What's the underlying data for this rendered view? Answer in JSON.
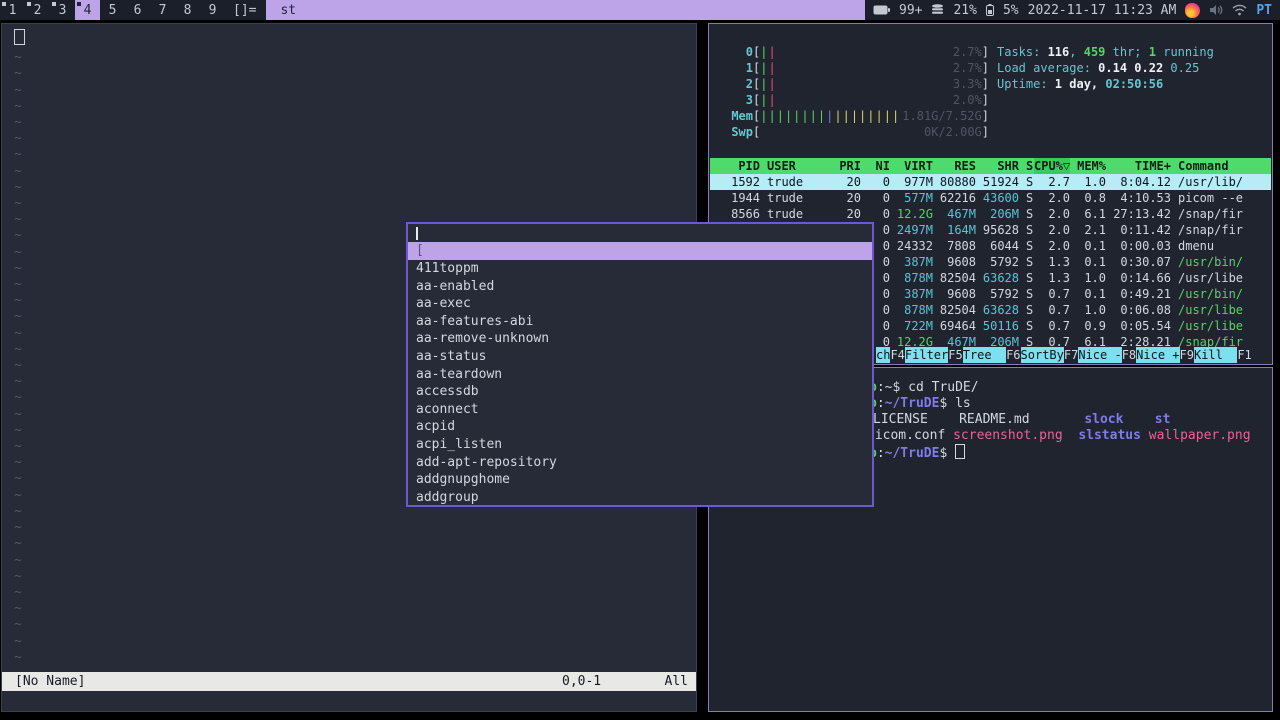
{
  "bar": {
    "workspaces": [
      {
        "label": "1",
        "indicator": true,
        "selected": false
      },
      {
        "label": "2",
        "indicator": true,
        "selected": false
      },
      {
        "label": "3",
        "indicator": true,
        "selected": false
      },
      {
        "label": "4",
        "indicator": true,
        "selected": true
      },
      {
        "label": "5",
        "indicator": false,
        "selected": false
      },
      {
        "label": "6",
        "indicator": false,
        "selected": false
      },
      {
        "label": "7",
        "indicator": false,
        "selected": false
      },
      {
        "label": "8",
        "indicator": false,
        "selected": false
      },
      {
        "label": "9",
        "indicator": false,
        "selected": false
      }
    ],
    "layout_symbol": "[]=",
    "window_title": "st",
    "status": {
      "battery": "99+",
      "memory": "21%",
      "cpu": "5%",
      "clock": "2022-11-17 11:23 AM",
      "keyboard_layout": "PT"
    },
    "icons": {
      "battery": "battery-icon",
      "memory": "database-icon",
      "cpu": "battery-small-icon",
      "tray": [
        "firefox-icon",
        "volume-icon",
        "wifi-icon"
      ]
    }
  },
  "vim": {
    "tilde": "~",
    "tilde_count": 38,
    "status_file": "[No Name]",
    "status_position": "0,0-1",
    "status_scroll": "All"
  },
  "htop": {
    "meters": [
      {
        "label": "0",
        "bars": "gr",
        "value": "2.7%"
      },
      {
        "label": "1",
        "bars": "gr",
        "value": "2.7%"
      },
      {
        "label": "2",
        "bars": "gr",
        "value": "3.3%"
      },
      {
        "label": "3",
        "bars": "gr",
        "value": "2.0%"
      },
      {
        "label": "Mem",
        "bars": "ggggggggbyyyyyyyyy",
        "value": "1.81G/7.52G"
      },
      {
        "label": "Swp",
        "bars": "",
        "value": "0K/2.00G"
      }
    ],
    "info": [
      [
        [
          "Tasks: ",
          "fg-cy"
        ],
        [
          "116",
          "fg-wb"
        ],
        [
          ", ",
          "fg-cy"
        ],
        [
          "459",
          "fg-gnb"
        ],
        [
          " thr; ",
          "fg-cy"
        ],
        [
          "1",
          "fg-gnb"
        ],
        [
          " running",
          "fg-cy"
        ]
      ],
      [
        [
          "Load average: ",
          "fg-cy"
        ],
        [
          "0.14 ",
          "fg-wb"
        ],
        [
          "0.22 ",
          "fg-wb"
        ],
        [
          "0.25",
          "fg-cy"
        ]
      ],
      [
        [
          "Uptime: ",
          "fg-cy"
        ],
        [
          "1 day, ",
          "fg-wb"
        ],
        [
          "02:50:56",
          "fg-cyb"
        ]
      ]
    ],
    "columns": [
      "PID",
      "USER",
      "PRI",
      "NI",
      "VIRT",
      "RES",
      "SHR",
      "S",
      "CPU%▽",
      "MEM%",
      "TIME+",
      "Command"
    ],
    "rows": [
      {
        "selected": true,
        "cells": [
          "1592",
          "trude",
          "20",
          "0",
          "977M",
          "80880",
          "51924",
          "S",
          "2.7",
          "1.0",
          "8:04.12",
          "/usr/lib/"
        ]
      },
      {
        "selected": false,
        "cells": [
          "1944",
          "trude",
          "20",
          "0",
          [
            "577M",
            "fg-teal"
          ],
          "62216",
          [
            "43600",
            "fg-teal"
          ],
          "S",
          "2.0",
          "0.8",
          "4:10.53",
          "picom --e"
        ]
      },
      {
        "selected": false,
        "cells": [
          "8566",
          "trude",
          "20",
          "0",
          [
            "12.2G",
            "fg-gn"
          ],
          [
            "467M",
            "fg-teal"
          ],
          [
            "206M",
            "fg-teal"
          ],
          "S",
          "2.0",
          "6.1",
          "27:13.42",
          "/snap/fir"
        ]
      },
      {
        "selected": false,
        "cells": [
          "",
          "",
          "",
          "0",
          [
            "2497M",
            "fg-teal"
          ],
          [
            "164M",
            "fg-teal"
          ],
          "95628",
          "S",
          "2.0",
          "2.1",
          "0:11.42",
          "/snap/fir"
        ]
      },
      {
        "selected": false,
        "cells": [
          "",
          "",
          "",
          "0",
          "24332",
          "7808",
          "6044",
          "S",
          "2.0",
          "0.1",
          "0:00.03",
          "dmenu"
        ]
      },
      {
        "selected": false,
        "cells": [
          "",
          "",
          "",
          "0",
          [
            "387M",
            "fg-teal"
          ],
          "9608",
          "5792",
          "S",
          "1.3",
          "0.1",
          "0:30.07",
          [
            "/usr/bin/",
            "fg-gn"
          ]
        ]
      },
      {
        "selected": false,
        "cells": [
          "",
          "",
          "",
          "0",
          [
            "878M",
            "fg-teal"
          ],
          "82504",
          [
            "63628",
            "fg-teal"
          ],
          "S",
          "1.3",
          "1.0",
          "0:14.66",
          "/usr/libe"
        ]
      },
      {
        "selected": false,
        "cells": [
          "",
          "",
          "",
          "0",
          [
            "387M",
            "fg-teal"
          ],
          "9608",
          "5792",
          "S",
          "0.7",
          "0.1",
          "0:49.21",
          [
            "/usr/bin/",
            "fg-gn"
          ]
        ]
      },
      {
        "selected": false,
        "cells": [
          "",
          "",
          "",
          "0",
          [
            "878M",
            "fg-teal"
          ],
          "82504",
          [
            "63628",
            "fg-teal"
          ],
          "S",
          "0.7",
          "1.0",
          "0:06.08",
          [
            "/usr/libe",
            "fg-gn"
          ]
        ]
      },
      {
        "selected": false,
        "cells": [
          "",
          "",
          "",
          "0",
          [
            "722M",
            "fg-teal"
          ],
          "69464",
          [
            "50116",
            "fg-teal"
          ],
          "S",
          "0.7",
          "0.9",
          "0:05.54",
          [
            "/usr/libe",
            "fg-gn"
          ]
        ]
      },
      {
        "selected": false,
        "cells": [
          "",
          "",
          "",
          "0",
          [
            "12.2G",
            "fg-gn"
          ],
          [
            "467M",
            "fg-teal"
          ],
          [
            "206M",
            "fg-teal"
          ],
          "S",
          "0.7",
          "6.1",
          "2:28.21",
          [
            "/snap/fir",
            "fg-gn"
          ]
        ]
      }
    ],
    "fnkeys": [
      {
        "key": "",
        "label": "ch"
      },
      {
        "key": "F4",
        "label": "Filter"
      },
      {
        "key": "F5",
        "label": "Tree  "
      },
      {
        "key": "F6",
        "label": "SortBy"
      },
      {
        "key": "F7",
        "label": "Nice -"
      },
      {
        "key": "F8",
        "label": "Nice +"
      },
      {
        "key": "F9",
        "label": "Kill  "
      },
      {
        "key": "F1",
        "label": ""
      }
    ]
  },
  "terminal": {
    "lines": [
      {
        "pad": 160,
        "cursor": false,
        "segs": [
          [
            "p",
            "fg-gnb"
          ],
          [
            ":",
            "fg-w"
          ],
          [
            "~",
            "fg-w"
          ],
          [
            "$",
            "fg-w"
          ],
          [
            " cd TruDE/",
            "fg-w"
          ]
        ]
      },
      {
        "pad": 160,
        "cursor": false,
        "segs": [
          [
            "p",
            "fg-gnb"
          ],
          [
            ":",
            "fg-w"
          ],
          [
            "~/TruDE",
            "fg-blb"
          ],
          [
            "$",
            "fg-w"
          ],
          [
            " ls",
            "fg-w"
          ]
        ]
      },
      {
        "pad": 164,
        "cursor": false,
        "segs": [
          [
            "LICENSE    ",
            "fg-w"
          ],
          [
            "README.md       ",
            "fg-w"
          ],
          [
            "slock    ",
            "fg-blb"
          ],
          [
            "st",
            "fg-blb"
          ]
        ]
      },
      {
        "pad": 158,
        "cursor": false,
        "segs": [
          [
            "picom.conf ",
            "fg-w"
          ],
          [
            "screenshot.png  ",
            "fg-pk"
          ],
          [
            "slstatus ",
            "fg-blb"
          ],
          [
            "wallpaper.png",
            "fg-pk"
          ]
        ]
      },
      {
        "pad": 160,
        "cursor": true,
        "segs": [
          [
            "p",
            "fg-gnb"
          ],
          [
            ":",
            "fg-w"
          ],
          [
            "~/TruDE",
            "fg-blb"
          ],
          [
            "$ ",
            "fg-w"
          ]
        ]
      }
    ]
  },
  "dmenu": {
    "query": "",
    "selected_item": "[",
    "items": [
      "411toppm",
      "aa-enabled",
      "aa-exec",
      "aa-features-abi",
      "aa-remove-unknown",
      "aa-status",
      "aa-teardown",
      "accessdb",
      "aconnect",
      "acpid",
      "acpi_listen",
      "add-apt-repository",
      "addgnupghome",
      "addgroup"
    ]
  }
}
